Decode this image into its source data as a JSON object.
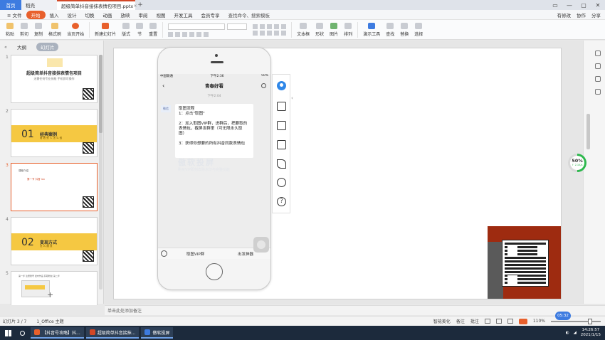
{
  "tabs": {
    "home": "首页",
    "wps": "稻壳",
    "doc": "超级简单抖音接抹表情包项目.pptx",
    "close": "×",
    "plus": "+"
  },
  "window_controls": [
    "▭",
    "—",
    "▢",
    "✕"
  ],
  "menu": {
    "file": "≡ 文件",
    "items": [
      "开始",
      "插入",
      "设计",
      "切换",
      "动画",
      "放映",
      "审阅",
      "视图",
      "开发工具",
      "会员专享"
    ],
    "active_index": 0,
    "search": "查找命令、搜索模板",
    "right": [
      "有修改",
      "协作",
      "分享"
    ]
  },
  "ribbon": {
    "groups": [
      "粘贴",
      "剪切",
      "复制",
      "格式刷",
      "当页开始",
      "新建幻灯片",
      "版式",
      "节",
      "重置"
    ],
    "right_groups": [
      "文本框",
      "形状",
      "图片",
      "排列",
      "演示工具",
      "查找",
      "替换",
      "选择"
    ]
  },
  "panel": {
    "tab_outline": "大纲",
    "tab_slides": "幻灯片",
    "collapse": "«",
    "slides": [
      {
        "num": "1",
        "title": "超级简单抖音接抹表情包项目",
        "sub": "无需任何专业技能 手机即可操作"
      },
      {
        "num": "2",
        "band_num": "01",
        "band_title": "经典案例",
        "band_sub": "看 看 别 人 怎 么 做"
      },
      {
        "num": "3",
        "a": "课程介绍",
        "b": "第一节 抖音 ico"
      },
      {
        "num": "4",
        "band_num": "02",
        "band_title": "变现方式",
        "band_sub": "怎 么 赚 钱"
      },
      {
        "num": "5",
        "a": "第一步 注册账号 发布作品 获取粉丝 第二步"
      }
    ],
    "add": "+"
  },
  "phone": {
    "status_left": "中国联通",
    "status_time": "下午2:36",
    "status_right": "50%",
    "title": "青春好看",
    "back": "‹",
    "time": "下午2:04",
    "avatar_label": "微信",
    "message": "取图流程\n1：点击\"取图\"\n\n2：加入取图VIP群，进群后，把要取的表情包，截屏发群里（可无限永久取图）\n\n3：获得你想要的所有抖音同款表情包",
    "watermark": "傲软投屏",
    "watermark_sub": "购买VIP即刻去除水印与完整功能",
    "bar_left": "取图VIP群",
    "bar_right": "出发神器"
  },
  "vtoolbar_icons": [
    "user-icon",
    "fullscreen-icon",
    "screenshot-icon",
    "record-icon",
    "brush-icon",
    "settings-icon",
    "help-icon"
  ],
  "vtoolbar_arrow": "‹",
  "help_glyph": "?",
  "progress": {
    "percent_label": "50%",
    "percent_value": 50,
    "speed": "↑ 2.1K/s"
  },
  "notes_placeholder": "单击此处添加备注",
  "statusbar": {
    "slide_info": "幻灯片 3 / 7",
    "theme": "1_Office 主题",
    "smart": "智能美化",
    "notes": "备注",
    "comment": "批注",
    "zoom": "110%"
  },
  "timer": "05:32",
  "taskbar": {
    "apps": [
      "【抖音号攻略】抖...",
      "超级简单抖音接抹...",
      "傲软投屏"
    ],
    "time": "14:26:57",
    "date": "2021/1/15"
  },
  "colors": {
    "accent": "#e8602c",
    "brand_blue": "#3d7be0",
    "progress_green": "#2db84d",
    "qr_red": "#9e2b10"
  }
}
